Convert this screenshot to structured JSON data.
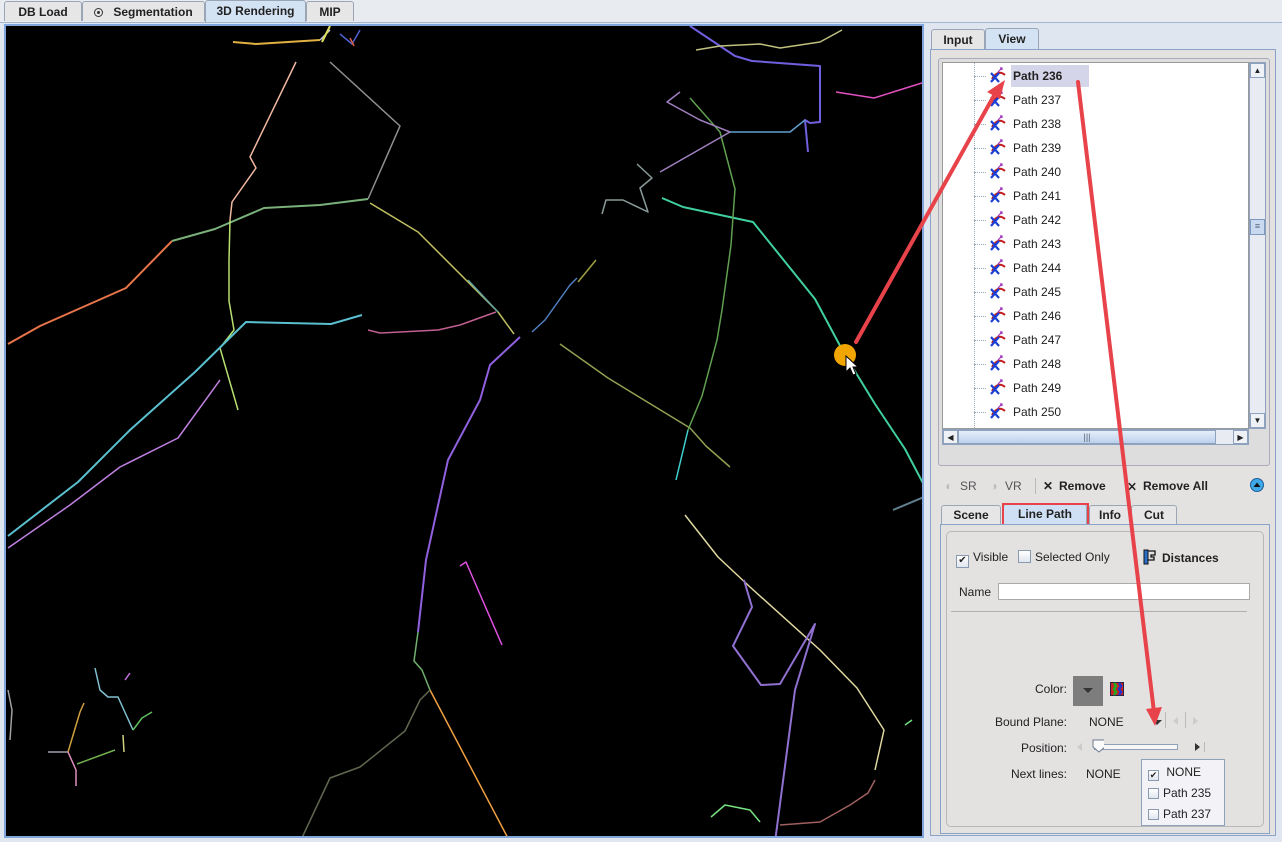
{
  "main_tabs": [
    {
      "label": "DB Load",
      "active": false
    },
    {
      "label": "Segmentation",
      "active": false,
      "icon": "radio-dot-icon"
    },
    {
      "label": "3D Rendering",
      "active": true
    },
    {
      "label": "MIP",
      "active": false
    }
  ],
  "side_tabs": [
    {
      "label": "Input",
      "active": false
    },
    {
      "label": "View",
      "active": true
    }
  ],
  "tree": {
    "selected": "Path 236",
    "items": [
      {
        "label": "Path 236",
        "icon": "line-path-icon"
      },
      {
        "label": "Path 237",
        "icon": "line-path-icon"
      },
      {
        "label": "Path 238",
        "icon": "line-path-icon"
      },
      {
        "label": "Path 239",
        "icon": "line-path-icon"
      },
      {
        "label": "Path 240",
        "icon": "line-path-icon"
      },
      {
        "label": "Path 241",
        "icon": "line-path-icon"
      },
      {
        "label": "Path 242",
        "icon": "line-path-icon"
      },
      {
        "label": "Path 243",
        "icon": "line-path-icon"
      },
      {
        "label": "Path 244",
        "icon": "line-path-icon"
      },
      {
        "label": "Path 245",
        "icon": "line-path-icon"
      },
      {
        "label": "Path 246",
        "icon": "line-path-icon"
      },
      {
        "label": "Path 247",
        "icon": "line-path-icon"
      },
      {
        "label": "Path 248",
        "icon": "line-path-icon"
      },
      {
        "label": "Path 249",
        "icon": "line-path-icon"
      },
      {
        "label": "Path 250",
        "icon": "line-path-icon"
      }
    ]
  },
  "toolbar": {
    "sr_label": "SR",
    "vr_label": "VR",
    "remove_label": "Remove",
    "remove_all_label": "Remove All"
  },
  "lower_tabs": [
    {
      "label": "Scene",
      "active": false
    },
    {
      "label": "Line Path",
      "active": true
    },
    {
      "label": "Info",
      "active": false
    },
    {
      "label": "Cut",
      "active": false
    }
  ],
  "line_path": {
    "visible_label": "Visible",
    "visible_checked": true,
    "selected_only_label": "Selected Only",
    "selected_only_checked": false,
    "distances_label": "Distances",
    "name_label": "Name",
    "name_value": "",
    "color_label": "Color:",
    "color_value": "#7d7d7d",
    "bound_plane_label": "Bound Plane:",
    "bound_plane_value": "NONE",
    "position_label": "Position:",
    "position_value": 0.1,
    "next_lines_label": "Next lines:",
    "next_lines_value": "NONE"
  },
  "next_lines_popup": {
    "items": [
      {
        "label": "NONE",
        "checked": true
      },
      {
        "label": "Path 235",
        "checked": false
      },
      {
        "label": "Path 237",
        "checked": false
      }
    ]
  },
  "annotations": {
    "arrow_color": "#e8434a",
    "marker_color": "#f0a500"
  }
}
